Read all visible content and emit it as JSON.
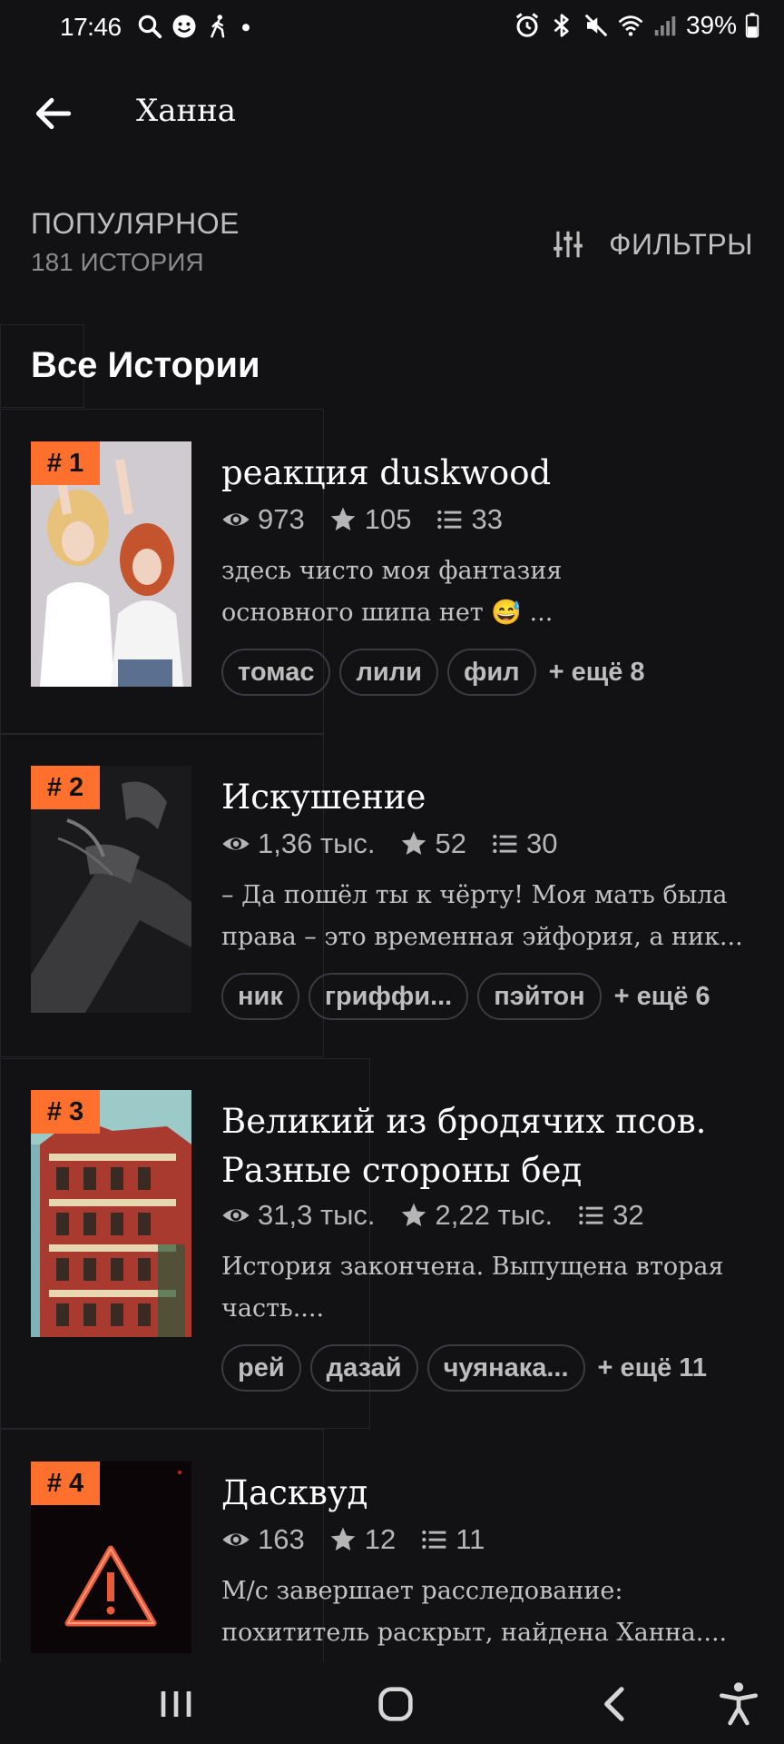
{
  "status_bar": {
    "time": "17:46",
    "battery_percent": "39%",
    "left_icons": [
      "search-icon",
      "face-icon",
      "walking-icon",
      "dot-icon"
    ],
    "right_icons": [
      "alarm-icon",
      "bluetooth-icon",
      "mute-icon",
      "wifi-icon",
      "signal-icon",
      "battery-icon"
    ]
  },
  "header": {
    "title": "Ханна"
  },
  "section": {
    "label": "ПОПУЛЯРНОЕ",
    "count": "181 ИСТОРИЯ",
    "filters_label": "ФИЛЬТРЫ"
  },
  "list_title": "Все Истории",
  "stories": [
    {
      "rank": "# 1",
      "title": "реакция duskwood",
      "views": "973",
      "votes": "105",
      "parts": "33",
      "desc_line1": "здесь чисто моя фантазия",
      "desc_line2": "основного шипа нет 😅 ...",
      "tags": [
        "томас",
        "лили",
        "фил"
      ],
      "more": "+ ещё 8"
    },
    {
      "rank": "# 2",
      "title": "Искушение",
      "views": "1,36 тыс.",
      "votes": "52",
      "parts": "30",
      "desc_line1": "– Да пошёл ты к чёрту! Моя мать была",
      "desc_line2": "права – это временная эйфория, а ник...",
      "tags": [
        "ник",
        "гриффи...",
        "пэйтон"
      ],
      "more": "+ ещё 6"
    },
    {
      "rank": "# 3",
      "title_line1": "Великий из бродячих псов.",
      "title_line2": "Разные стороны бед",
      "views": "31,3 тыс.",
      "votes": "2,22 тыс.",
      "parts": "32",
      "desc_line1": "История закончена. Выпущена вторая",
      "desc_line2": "часть....",
      "tags": [
        "рей",
        "дазай",
        "чуянака..."
      ],
      "more": "+ ещё 11"
    },
    {
      "rank": "# 4",
      "title": "Дасквуд",
      "views": "163",
      "votes": "12",
      "parts": "11",
      "desc_line1": "М/с завершает расследование:",
      "desc_line2": "похититель раскрыт, найдена Ханна...."
    }
  ],
  "colors": {
    "background": "#121114",
    "accent_rank": "#ff6f2e",
    "text_secondary": "#bdbdbd"
  },
  "nav_bar": {
    "icons": [
      "recents-icon",
      "home-icon",
      "back-icon",
      "accessibility-icon"
    ]
  }
}
